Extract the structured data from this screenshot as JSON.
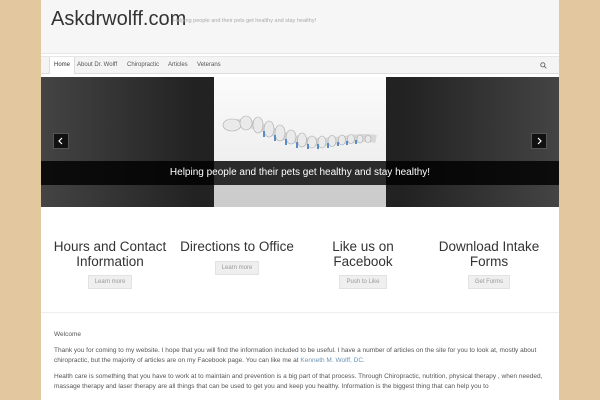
{
  "site": {
    "title": "Askdrwolff.com",
    "tagline": "Helping people and their pets get healthy and stay healthy!"
  },
  "nav": {
    "items": [
      {
        "label": "Home",
        "active": true
      },
      {
        "label": "About Dr. Wolff"
      },
      {
        "label": "Chiropractic"
      },
      {
        "label": "Articles"
      },
      {
        "label": "Veterans"
      }
    ],
    "search_icon": "search-icon"
  },
  "slider": {
    "caption": "Helping people and their pets get healthy and stay healthy!",
    "image": "spine-model-image",
    "prev_icon": "chevron-left-icon",
    "next_icon": "chevron-right-icon"
  },
  "features": [
    {
      "title": "Hours and Contact Information",
      "button": "Learn more"
    },
    {
      "title": "Directions to Office",
      "button": "Learn more"
    },
    {
      "title": "Like us on Facebook",
      "button": "Push to Like"
    },
    {
      "title": "Download Intake Forms",
      "button": "Get Forms"
    }
  ],
  "content": {
    "heading": "Welcome",
    "para1_text": "Thank you for coming to my website. I hope that you will find the information included to be useful. I have a number of articles on the site for you to look at, mostly about chiropractic, but the majority of articles are on my Facebook page. You can like me at ",
    "para1_link": "Kenneth M. Wolff, DC.",
    "para2": "Health care is something that you have to work at to maintain and prevention is a big part of that process. Through Chiropractic, nutrition, physical therapy , when needed, massage therapy and laser therapy are all things that can be used to get you and keep you healthy. Information is the biggest thing that can help you to"
  },
  "colors": {
    "background": "#e2c79f",
    "link": "#6c93b5"
  }
}
